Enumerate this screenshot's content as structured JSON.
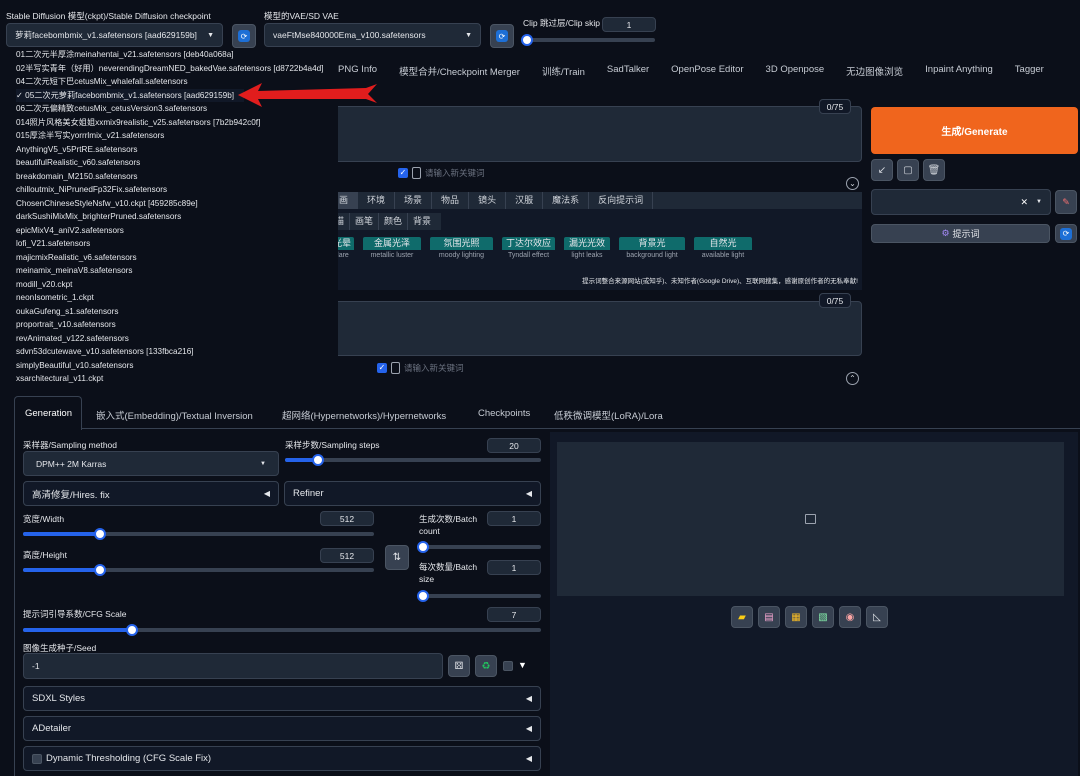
{
  "topbar": {
    "checkpoint_label": "Stable Diffusion 模型(ckpt)/Stable Diffusion checkpoint",
    "checkpoint_value": "萝莉facebombmix_v1.safetensors [aad629159b]",
    "vae_label": "模型的VAE/SD VAE",
    "vae_value": "vaeFtMse840000Ema_v100.safetensors",
    "clip_label": "Clip 跳过层/Clip skip",
    "clip_value": "1"
  },
  "checkpoint_list": [
    "01二次元半厚涂meinahentai_v21.safetensors [deb40a068a]",
    "02半写实青年（好用）neverendingDreamNED_bakedVae.safetensors [d8722b4a4d]",
    "04二次元短下巴cetusMix_whalefall.safetensors",
    "✓ 05二次元萝莉facebombmix_v1.safetensors [aad629159b]",
    "06二次元偏精致cetusMix_cetusVersion3.safetensors",
    "014照片风格美女姐姐xxmix9realistic_v25.safetensors [7b2b942c0f]",
    "015厚涂半写实yorrrlmix_v21.safetensors",
    "AnythingV5_v5PrtRE.safetensors",
    "beautifulRealistic_v60.safetensors",
    "breakdomain_M2150.safetensors",
    "chilloutmix_NiPrunedFp32Fix.safetensors",
    "ChosenChineseStyleNsfw_v10.ckpt [459285c89e]",
    "darkSushiMixMix_brighterPruned.safetensors",
    "epicMixV4_aniV2.safetensors",
    "lofi_V21.safetensors",
    "majicmixRealistic_v6.safetensors",
    "meinamix_meinaV8.safetensors",
    "modill_v20.ckpt",
    "neonIsometric_1.ckpt",
    "oukaGufeng_s1.safetensors",
    "proportrait_v10.safetensors",
    "revAnimated_v122.safetensors",
    "sdvn53dcutewave_v10.safetensors [133fbca216]",
    "simplyBeautiful_v10.safetensors",
    "xsarchitectural_v11.ckpt"
  ],
  "main_tabs": [
    "PNG Info",
    "模型合并/Checkpoint Merger",
    "训练/Train",
    "SadTalker",
    "OpenPose Editor",
    "3D Openpose",
    "无边图像浏览",
    "Inpaint Anything",
    "Tagger"
  ],
  "prompt": {
    "counter": "0/75",
    "keyword_placeholder": "请输入新关键词",
    "categories": [
      "画",
      "环境",
      "场景",
      "物品",
      "镜头",
      "汉服",
      "魔法系",
      "反向提示词"
    ],
    "subcategories": [
      "描",
      "画笔",
      "颜色",
      "背景"
    ],
    "chips": [
      {
        "zh": "光晕",
        "en": "flare"
      },
      {
        "zh": "金属光泽",
        "en": "metallic luster"
      },
      {
        "zh": "氛围光照",
        "en": "moody lighting"
      },
      {
        "zh": "丁达尔效应",
        "en": "Tyndall effect"
      },
      {
        "zh": "漏光光效",
        "en": "light leaks"
      },
      {
        "zh": "背景光",
        "en": "background light"
      },
      {
        "zh": "自然光",
        "en": "available light"
      }
    ],
    "notice": "提示词整合来源网站(或知乎)、未知作者(Google Drive)、互联网搜集，感谢原创作者的无私奉献!"
  },
  "negative_prompt": {
    "counter": "0/75",
    "keyword_placeholder": "请输入新关键词"
  },
  "right": {
    "generate_label": "生成/Generate",
    "prompt_btn_label": "提示词"
  },
  "gen_tabs": [
    "Generation",
    "嵌入式(Embedding)/Textual Inversion",
    "超网络(Hypernetworks)/Hypernetworks",
    "Checkpoints",
    "低秩微调模型(LoRA)/Lora"
  ],
  "params": {
    "sampler_label": "采样器/Sampling method",
    "sampler_value": "DPM++ 2M Karras",
    "steps_label": "采样步数/Sampling steps",
    "steps_value": "20",
    "steps_fraction": 0.13,
    "hires_label": "高清修复/Hires. fix",
    "refiner_label": "Refiner",
    "width_label": "宽度/Width",
    "width_value": "512",
    "width_fraction": 0.22,
    "height_label": "高度/Height",
    "height_value": "512",
    "height_fraction": 0.22,
    "batch_count_label": "生成次数/Batch count",
    "batch_count_value": "1",
    "batch_size_label": "每次数量/Batch size",
    "batch_size_value": "1",
    "cfg_label": "提示词引导系数/CFG Scale",
    "cfg_value": "7",
    "cfg_fraction": 0.21,
    "seed_label": "图像生成种子/Seed",
    "seed_value": "-1",
    "accordions": [
      "SDXL Styles",
      "ADetailer",
      "Dynamic Thresholding (CFG Scale Fix)"
    ]
  },
  "colors": {
    "background": "#0b0f19",
    "accent_blue": "#2563eb",
    "generate_orange": "#f0651d",
    "arrow_red": "#e11d1d",
    "chip_teal": "#0f6b6b"
  }
}
